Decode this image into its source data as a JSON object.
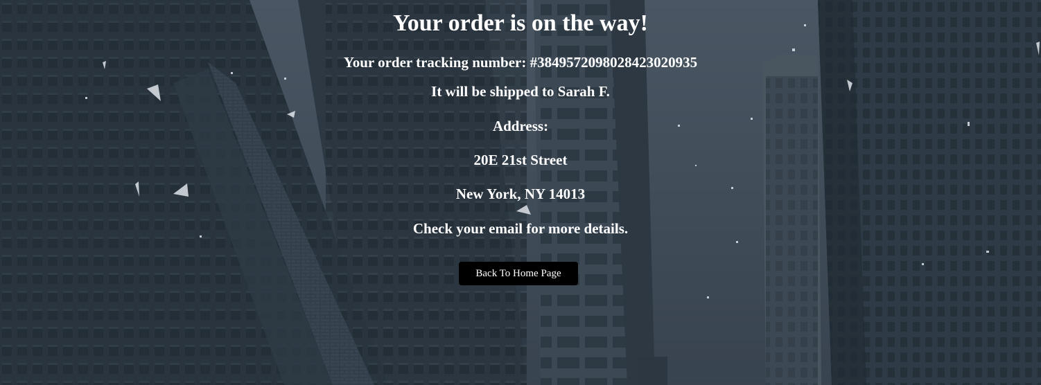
{
  "confirmation": {
    "title": "Your order is on the way!",
    "tracking_line": "Your order tracking number: #384957209802842302093​5",
    "shipped_to": "It will be shipped to Sarah F.",
    "address_label": "Address:",
    "street": "20E 21st Street",
    "city_state_zip": "New York, NY 14013",
    "email_note": "Check your email for more details."
  },
  "actions": {
    "back_home_label": "Back To Home Page"
  },
  "colors": {
    "text": "#ffffff",
    "button_bg": "#000000",
    "background_tint": "#3b4652"
  }
}
